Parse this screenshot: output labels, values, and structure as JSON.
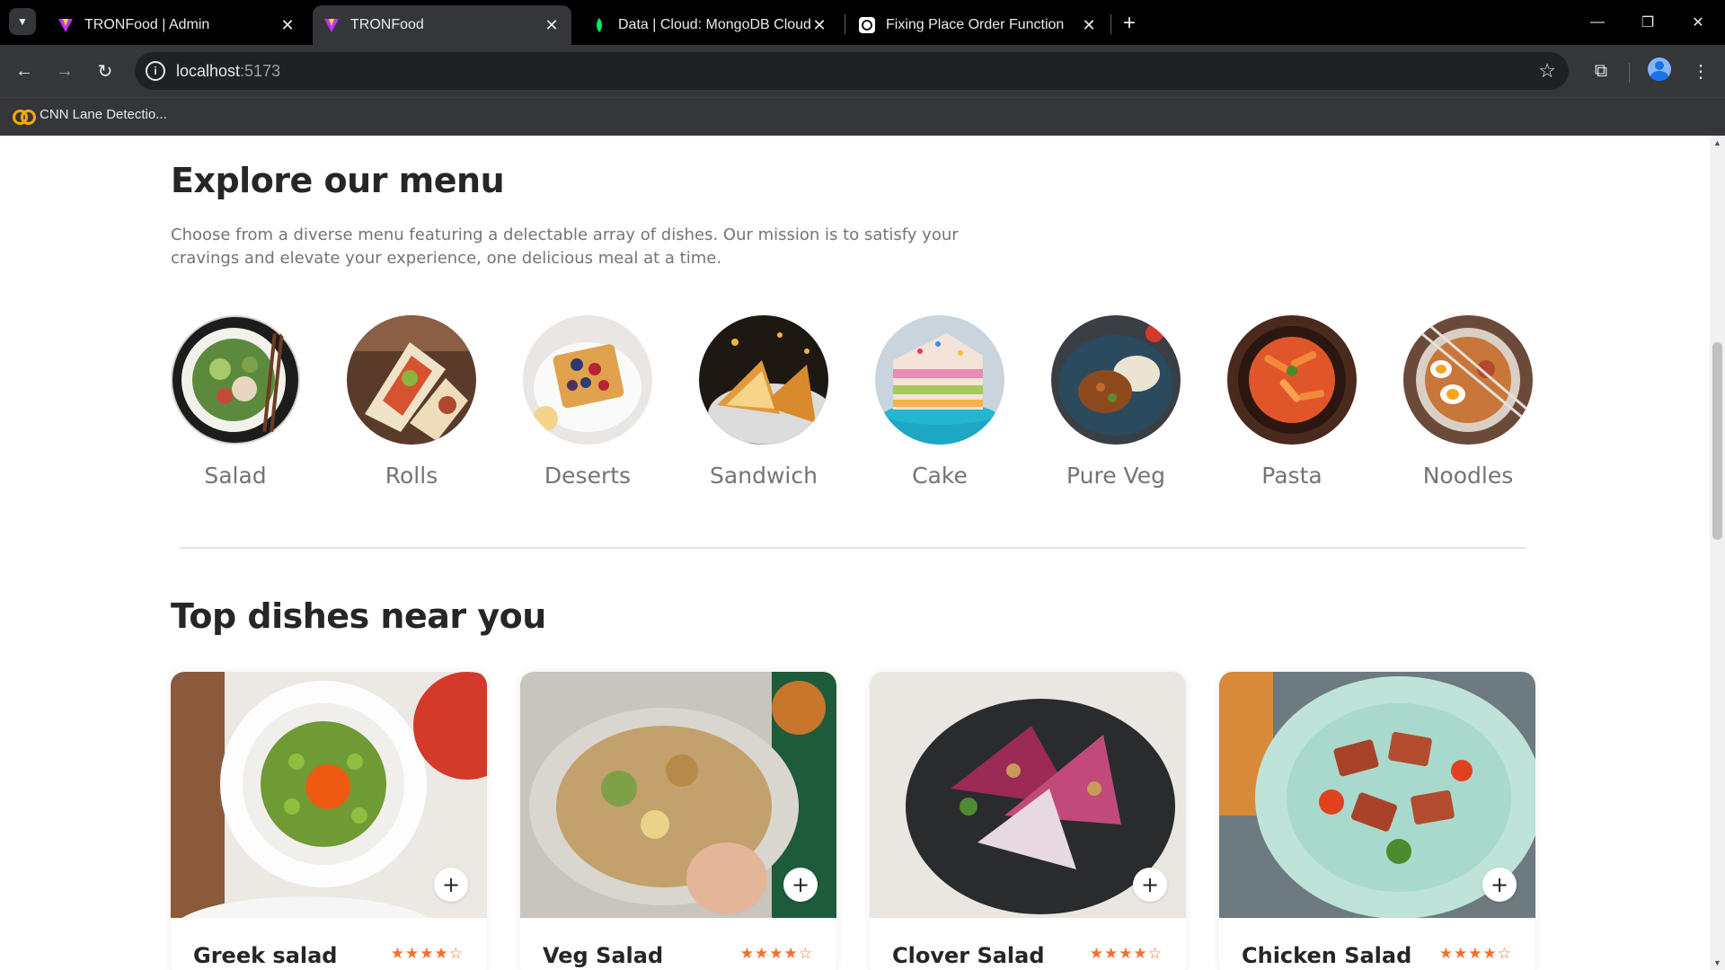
{
  "browser": {
    "tabs": [
      {
        "title": "TRONFood | Admin",
        "active": false
      },
      {
        "title": "TRONFood",
        "active": true
      },
      {
        "title": "Data | Cloud: MongoDB Cloud",
        "active": false
      },
      {
        "title": "Fixing Place Order Function",
        "active": false
      }
    ],
    "address": {
      "host": "localhost",
      "port": ":5173"
    },
    "bookmarks": [
      {
        "label": "CNN Lane Detectio..."
      }
    ]
  },
  "menu": {
    "title": "Explore our menu",
    "description": "Choose from a diverse menu featuring a delectable array of dishes. Our mission is to satisfy your cravings and elevate your experience, one delicious meal at a time.",
    "categories": [
      "Salad",
      "Rolls",
      "Deserts",
      "Sandwich",
      "Cake",
      "Pure Veg",
      "Pasta",
      "Noodles"
    ]
  },
  "top_dishes": {
    "title": "Top dishes near you",
    "items": [
      {
        "name": "Greek salad",
        "stars": "★★★★☆",
        "rating": 4
      },
      {
        "name": "Veg Salad",
        "stars": "★★★★☆",
        "rating": 4
      },
      {
        "name": "Clover Salad",
        "stars": "★★★★☆",
        "rating": 4
      },
      {
        "name": "Chicken Salad",
        "stars": "★★★★☆",
        "rating": 4
      }
    ],
    "add_label": "+"
  },
  "colors": {
    "accent": "#ff6b2b",
    "heading": "#262626",
    "muted": "#747474"
  }
}
